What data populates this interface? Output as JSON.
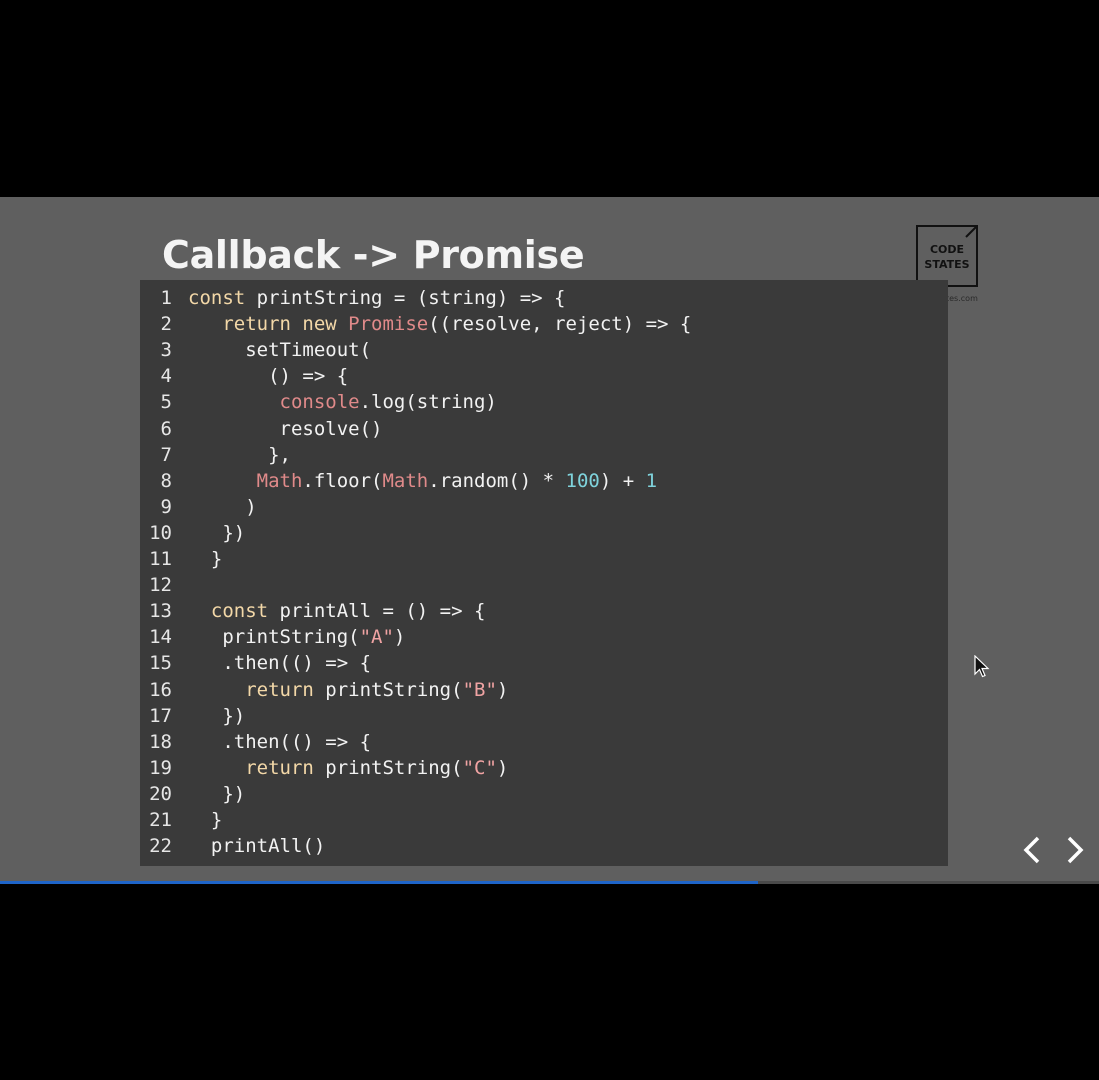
{
  "slide": {
    "title": "Callback -> Promise",
    "logo": {
      "line1": "CODE",
      "line2": "STATES",
      "url": "tes.com"
    }
  },
  "code": {
    "lines": [
      [
        [
          "const",
          "kw"
        ],
        [
          " printString = (string) => {",
          "plain"
        ]
      ],
      [
        [
          "   return new ",
          "kw"
        ],
        [
          "Promise",
          "obj"
        ],
        [
          "((resolve, reject) => {",
          "plain"
        ]
      ],
      [
        [
          "     setTimeout(",
          "plain"
        ]
      ],
      [
        [
          "       () => {",
          "plain"
        ]
      ],
      [
        [
          "        ",
          "plain"
        ],
        [
          "console",
          "obj"
        ],
        [
          ".log(string)",
          "plain"
        ]
      ],
      [
        [
          "        resolve()",
          "plain"
        ]
      ],
      [
        [
          "       },",
          "plain"
        ]
      ],
      [
        [
          "      ",
          "plain"
        ],
        [
          "Math",
          "obj"
        ],
        [
          ".floor(",
          "plain"
        ],
        [
          "Math",
          "obj"
        ],
        [
          ".random() * ",
          "plain"
        ],
        [
          "100",
          "num"
        ],
        [
          ") + ",
          "plain"
        ],
        [
          "1",
          "num"
        ]
      ],
      [
        [
          "     )",
          "plain"
        ]
      ],
      [
        [
          "   })",
          "plain"
        ]
      ],
      [
        [
          "  }",
          "plain"
        ]
      ],
      [
        [
          "",
          "plain"
        ]
      ],
      [
        [
          "  ",
          "plain"
        ],
        [
          "const",
          "kw"
        ],
        [
          " printAll = () => {",
          "plain"
        ]
      ],
      [
        [
          "   printString(",
          "plain"
        ],
        [
          "\"A\"",
          "str"
        ],
        [
          ")",
          "plain"
        ]
      ],
      [
        [
          "   .then(() => {",
          "plain"
        ]
      ],
      [
        [
          "     ",
          "plain"
        ],
        [
          "return",
          "kw"
        ],
        [
          " printString(",
          "plain"
        ],
        [
          "\"B\"",
          "str"
        ],
        [
          ")",
          "plain"
        ]
      ],
      [
        [
          "   })",
          "plain"
        ]
      ],
      [
        [
          "   .then(() => {",
          "plain"
        ]
      ],
      [
        [
          "     ",
          "plain"
        ],
        [
          "return",
          "kw"
        ],
        [
          " printString(",
          "plain"
        ],
        [
          "\"C\"",
          "str"
        ],
        [
          ")",
          "plain"
        ]
      ],
      [
        [
          "   })",
          "plain"
        ]
      ],
      [
        [
          "  }",
          "plain"
        ]
      ],
      [
        [
          "  printAll()",
          "plain"
        ]
      ]
    ]
  },
  "nav": {
    "prev_icon": "chevron-left-icon",
    "next_icon": "chevron-right-icon"
  },
  "progress": {
    "fraction": 0.69,
    "color": "#1e64c8"
  },
  "colors": {
    "background": "#000000",
    "slide": "#5f5f5f",
    "code_bg": "#3a3a3a",
    "keyword": "#f3d8a8",
    "object": "#e08a8a",
    "string": "#f0a3a3",
    "number": "#7fd3dc"
  }
}
